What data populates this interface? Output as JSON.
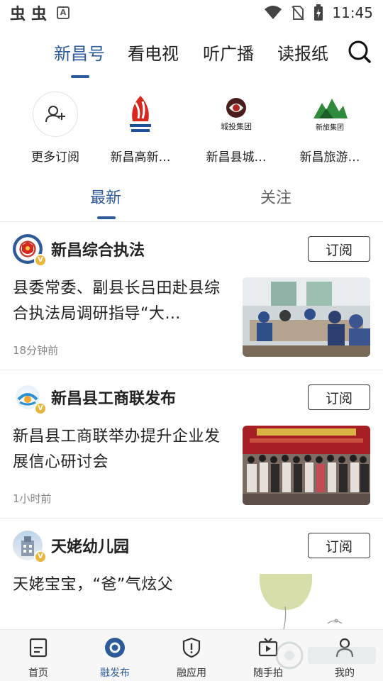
{
  "status_bar": {
    "left_glyphs": [
      "虫",
      "虫"
    ],
    "a_glyph": "A",
    "time": "11:45",
    "icons": [
      "wifi-icon",
      "no-sim-icon",
      "battery-charging-icon"
    ]
  },
  "top_tabs": {
    "items": [
      {
        "label": "新昌号",
        "active": true
      },
      {
        "label": "看电视",
        "active": false
      },
      {
        "label": "听广播",
        "active": false
      },
      {
        "label": "读报纸",
        "active": false
      }
    ],
    "search_icon": "search-icon"
  },
  "subscriptions": [
    {
      "name": "更多订阅",
      "logo_text": ""
    },
    {
      "name": "新昌高新…",
      "logo_text": ""
    },
    {
      "name": "新昌县城…",
      "logo_text": "城投集团"
    },
    {
      "name": "新昌旅游…",
      "logo_text": "新旅集团"
    }
  ],
  "feed_tabs": {
    "items": [
      {
        "label": "最新",
        "active": true
      },
      {
        "label": "关注",
        "active": false
      }
    ]
  },
  "cards": [
    {
      "source": "新昌综合执法",
      "subscribe_label": "订阅",
      "title": "县委常委、副县长吕田赴县综合执法局调研指导“大…",
      "time": "18分钟前",
      "badge": "V"
    },
    {
      "source": "新昌县工商联发布",
      "subscribe_label": "订阅",
      "title": "新昌县工商联举办提升企业发展信心研讨会",
      "time": "1小时前",
      "badge": "V"
    },
    {
      "source": "天姥幼儿园",
      "subscribe_label": "订阅",
      "title": "天姥宝宝，“爸”气炫父",
      "time": "",
      "badge": "V"
    }
  ],
  "bottom_nav": [
    {
      "label": "首页",
      "icon": "home-doc-icon",
      "active": false
    },
    {
      "label": "融发布",
      "icon": "publish-icon",
      "active": true
    },
    {
      "label": "融应用",
      "icon": "shield-app-icon",
      "active": false
    },
    {
      "label": "随手拍",
      "icon": "video-icon",
      "active": false
    },
    {
      "label": "我的",
      "icon": "person-icon",
      "active": false
    }
  ],
  "colors": {
    "accent": "#2d5b9a",
    "badge": "#e9b53b"
  }
}
